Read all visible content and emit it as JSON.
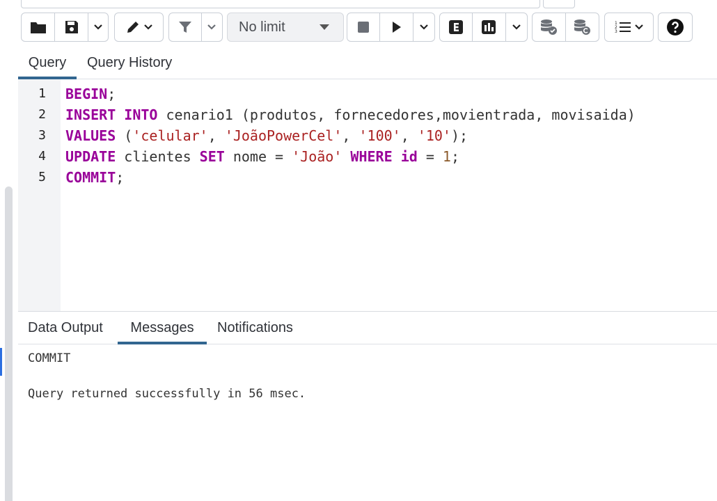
{
  "toolbar": {
    "limit_select": {
      "value": "No limit"
    },
    "icons": [
      "folder-icon",
      "save-icon",
      "chevron-down-icon",
      "pen-icon",
      "filter-icon",
      "stop-icon",
      "play-icon",
      "explain-icon",
      "analyze-icon",
      "commit-icon",
      "rollback-icon",
      "macros-icon",
      "help-icon"
    ]
  },
  "query_tabs": [
    {
      "label": "Query",
      "active": true
    },
    {
      "label": "Query History",
      "active": false
    }
  ],
  "editor": {
    "line_numbers": [
      "1",
      "2",
      "3",
      "4",
      "5"
    ],
    "lines": [
      [
        {
          "t": "BEGIN",
          "c": "kw"
        },
        {
          "t": ";",
          "c": ""
        }
      ],
      [
        {
          "t": "INSERT",
          "c": "kw"
        },
        {
          "t": " ",
          "c": ""
        },
        {
          "t": "INTO",
          "c": "kw"
        },
        {
          "t": " cenario1 (produtos, fornecedores,movientrada, movisaida)",
          "c": ""
        }
      ],
      [
        {
          "t": "VALUES",
          "c": "kw"
        },
        {
          "t": " (",
          "c": ""
        },
        {
          "t": "'celular'",
          "c": "str"
        },
        {
          "t": ", ",
          "c": ""
        },
        {
          "t": "'JoãoPowerCel'",
          "c": "str"
        },
        {
          "t": ", ",
          "c": ""
        },
        {
          "t": "'100'",
          "c": "str"
        },
        {
          "t": ", ",
          "c": ""
        },
        {
          "t": "'10'",
          "c": "str"
        },
        {
          "t": ");",
          "c": ""
        }
      ],
      [
        {
          "t": "UPDATE",
          "c": "kw"
        },
        {
          "t": " clientes ",
          "c": ""
        },
        {
          "t": "SET",
          "c": "kw"
        },
        {
          "t": " nome = ",
          "c": ""
        },
        {
          "t": "'João'",
          "c": "str"
        },
        {
          "t": " ",
          "c": ""
        },
        {
          "t": "WHERE",
          "c": "kw"
        },
        {
          "t": " ",
          "c": ""
        },
        {
          "t": "id",
          "c": "kw"
        },
        {
          "t": " = ",
          "c": ""
        },
        {
          "t": "1",
          "c": "num"
        },
        {
          "t": ";",
          "c": ""
        }
      ],
      [
        {
          "t": "COMMIT",
          "c": "kw"
        },
        {
          "t": ";",
          "c": ""
        }
      ]
    ]
  },
  "result_tabs": [
    {
      "label": "Data Output",
      "active": false
    },
    {
      "label": "Messages",
      "active": true
    },
    {
      "label": "Notifications",
      "active": false
    }
  ],
  "messages": [
    "COMMIT",
    "Query returned successfully in 56 msec."
  ],
  "colors": {
    "accent": "#326690",
    "keyword": "#990099",
    "string": "#aa2222",
    "number": "#8b5a2b"
  }
}
